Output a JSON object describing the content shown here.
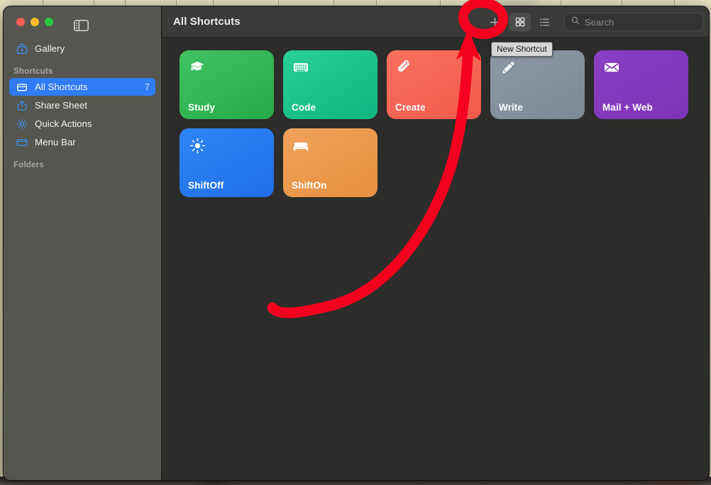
{
  "window": {
    "traffic_lights": [
      {
        "name": "close",
        "color": "#ff5f57"
      },
      {
        "name": "minimize",
        "color": "#febc2e"
      },
      {
        "name": "maximize",
        "color": "#28c840"
      }
    ],
    "sidebar_toggle_icon": "sidebar-toggle-icon"
  },
  "sidebar": {
    "gallery": {
      "label": "Gallery",
      "icon": "gallery-icon"
    },
    "sections": [
      {
        "label": "Shortcuts",
        "items": [
          {
            "label": "All Shortcuts",
            "icon": "folder-icon",
            "count": "7",
            "selected": true
          },
          {
            "label": "Share Sheet",
            "icon": "share-icon",
            "count": "",
            "selected": false
          },
          {
            "label": "Quick Actions",
            "icon": "gear-icon",
            "count": "",
            "selected": false
          },
          {
            "label": "Menu Bar",
            "icon": "menubar-icon",
            "count": "",
            "selected": false
          }
        ]
      },
      {
        "label": "Folders",
        "items": []
      }
    ]
  },
  "toolbar": {
    "title": "All Shortcuts",
    "new_shortcut_label": "+",
    "grid_view_icon": "grid-view-icon",
    "list_view_icon": "list-view-icon",
    "active_view": "grid",
    "search": {
      "icon": "search-icon",
      "value": "",
      "placeholder": "Search"
    }
  },
  "tooltip": {
    "text": "New Shortcut"
  },
  "shortcuts": [
    {
      "name": "Study",
      "icon": "graduation-cap-icon",
      "color_from": "#3fc463",
      "color_to": "#27a94a"
    },
    {
      "name": "Code",
      "icon": "keyboard-icon",
      "color_from": "#2ad096",
      "color_to": "#0fb580"
    },
    {
      "name": "Create",
      "icon": "paperclip-icon",
      "color_from": "#f9705f",
      "color_to": "#f25a4b"
    },
    {
      "name": "Write",
      "icon": "pencil-icon",
      "color_from": "#8d98a4",
      "color_to": "#7e8996"
    },
    {
      "name": "Mail + Web",
      "icon": "envelope-icon",
      "color_from": "#8a3fc4",
      "color_to": "#7c34b4"
    },
    {
      "name": "ShiftOff",
      "icon": "sun-icon",
      "color_from": "#2f85f7",
      "color_to": "#1f6fe8"
    },
    {
      "name": "ShiftOn",
      "icon": "bed-icon",
      "color_from": "#f0a25c",
      "color_to": "#e8913f"
    }
  ],
  "annotation": {
    "type": "hand-drawn-arrow-and-circle",
    "color": "#f5001e",
    "target": "New Shortcut (+) button"
  },
  "colors": {
    "accent": "#2f7cf6",
    "sidebar_bg": "#55564f",
    "toolbar_bg": "#3a3a38",
    "content_bg": "#2c2c2a",
    "annotation": "#f5001e"
  }
}
